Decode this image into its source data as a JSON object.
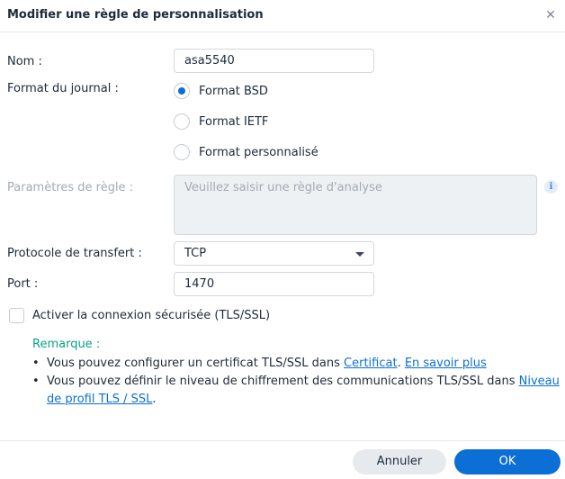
{
  "dialog": {
    "title": "Modifier une règle de personnalisation",
    "close_glyph": "✕"
  },
  "form": {
    "name_label": "Nom :",
    "name_value": "asa5540",
    "log_format_label": "Format du journal :",
    "log_formats": [
      {
        "label": "Format BSD",
        "selected": true
      },
      {
        "label": "Format IETF",
        "selected": false
      },
      {
        "label": "Format personnalisé",
        "selected": false
      }
    ],
    "rule_params_label": "Paramètres de règle :",
    "rule_params_placeholder": "Veuillez saisir une règle d'analyse",
    "info_glyph": "i",
    "transfer_protocol_label": "Protocole de transfert :",
    "transfer_protocol_value": "TCP",
    "port_label": "Port :",
    "port_value": "1470",
    "secure_connection_label": "Activer la connexion sécurisée (TLS/SSL)",
    "secure_connection_checked": false
  },
  "remark": {
    "title": "Remarque :",
    "bullet1_text": "Vous pouvez configurer un certificat TLS/SSL dans ",
    "bullet1_link1": "Certificat",
    "bullet1_sep": ". ",
    "bullet1_link2": "En savoir plus",
    "bullet2_text": "Vous pouvez définir le niveau de chiffrement des communications TLS/SSL dans ",
    "bullet2_link_part1": "Niveau",
    "bullet2_link_part2": "de profil TLS / SSL",
    "bullet2_end": ".",
    "bullet_glyph": "•"
  },
  "footer": {
    "cancel_label": "Annuler",
    "ok_label": "OK"
  },
  "colors": {
    "accent": "#0b6fd6",
    "remark": "#0aa08a",
    "disabled_text": "#a3abb5"
  },
  "icons": {
    "close": "close-icon",
    "info": "info-icon",
    "dropdown": "chevron-down-icon"
  }
}
